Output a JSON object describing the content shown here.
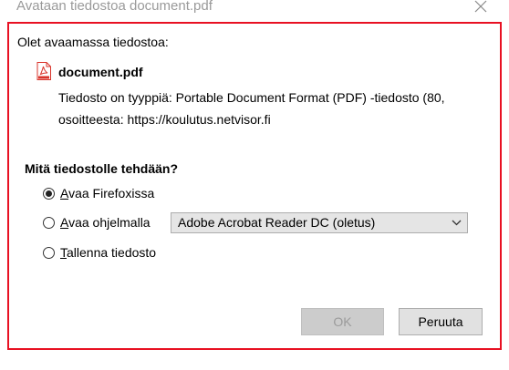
{
  "window": {
    "title": "Avataan tiedostoa document.pdf"
  },
  "dialog": {
    "intro": "Olet avaamassa tiedostoa:",
    "file_name": "document.pdf",
    "type_line": "Tiedosto on tyyppiä: Portable Document Format (PDF) -tiedosto (80,",
    "source_line": "osoitteesta: https://koulutus.netvisor.fi",
    "question": "Mitä tiedostolle tehdään?"
  },
  "options": {
    "open_firefox": {
      "mnemonic": "A",
      "rest": "vaa Firefoxissa",
      "checked": true
    },
    "open_with": {
      "mnemonic": "A",
      "rest": "vaa ohjelmalla",
      "checked": false
    },
    "save_file": {
      "mnemonic": "T",
      "rest": "allenna tiedosto",
      "checked": false
    }
  },
  "app_select": {
    "selected": "Adobe Acrobat Reader DC (oletus)"
  },
  "buttons": {
    "ok": "OK",
    "cancel": "Peruuta"
  },
  "icons": {
    "close": "close-icon",
    "file": "pdf-file-icon",
    "dropdown": "chevron-down-icon"
  },
  "colors": {
    "focus_border": "#e81123",
    "pdf_red": "#d9342b",
    "title_gray": "#9a9a9a",
    "select_bg": "#e5e5e5",
    "disabled_button_bg": "#cccccc"
  }
}
